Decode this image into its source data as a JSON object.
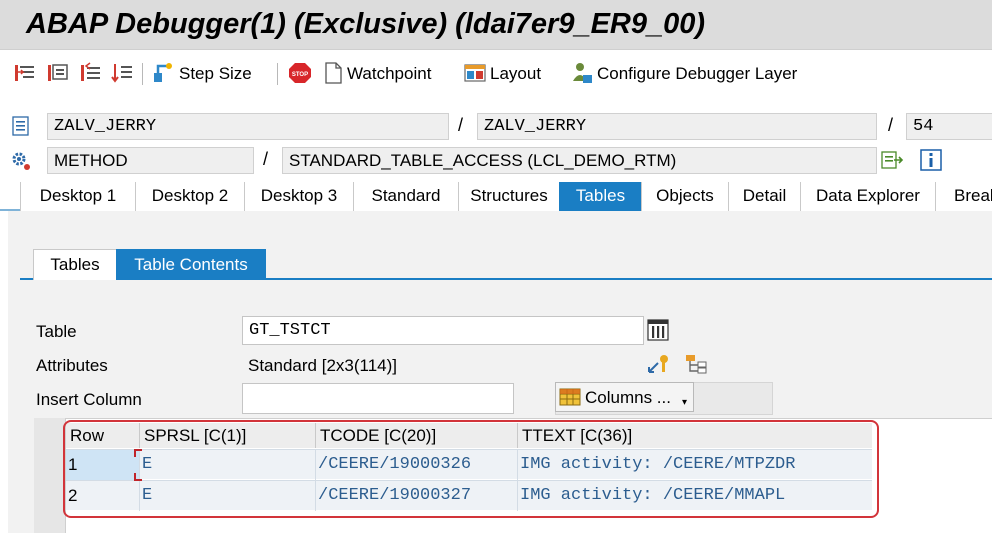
{
  "window": {
    "title": "ABAP Debugger(1)  (Exclusive) (ldai7er9_ER9_00)"
  },
  "toolbar": {
    "items": [
      {
        "label": "Step Size",
        "icon": "step-size-icon"
      },
      {
        "label": "Watchpoint",
        "icon": "watchpoint-icon"
      },
      {
        "label": "Layout",
        "icon": "layout-icon"
      },
      {
        "label": "Configure Debugger Layer",
        "icon": "configure-layer-icon"
      }
    ],
    "step_icons": [
      "single-step-icon",
      "execute-icon",
      "return-icon",
      "continue-icon"
    ]
  },
  "info": {
    "program": "ZALV_JERRY",
    "include": "ZALV_JERRY",
    "line": "54",
    "event_type": "METHOD",
    "event": "STANDARD_TABLE_ACCESS (LCL_DEMO_RTM)"
  },
  "main_tabs": [
    "Desktop 1",
    "Desktop 2",
    "Desktop 3",
    "Standard",
    "Structures",
    "Tables",
    "Objects",
    "Detail",
    "Data Explorer",
    "Break"
  ],
  "active_main_tab": "Tables",
  "sub_tabs": [
    "Tables",
    "Table Contents"
  ],
  "active_sub_tab": "Table Contents",
  "form": {
    "table_label": "Table",
    "table_value": "GT_TSTCT",
    "attributes_label": "Attributes",
    "attributes_value": "Standard [2x3(114)]",
    "insert_column_label": "Insert Column",
    "insert_column_value": "",
    "columns_button": "Columns ..."
  },
  "grid": {
    "headers": [
      "Row",
      "SPRSL [C(1)]",
      "TCODE [C(20)]",
      "TTEXT [C(36)]"
    ],
    "rows": [
      [
        "1",
        "E",
        "/CEERE/19000326",
        "IMG activity: /CEERE/MTPZDR"
      ],
      [
        "2",
        "E",
        "/CEERE/19000327",
        "IMG activity: /CEERE/MMAPL"
      ]
    ]
  },
  "colors": {
    "accent": "#1a7ec4",
    "highlight": "#d2343a",
    "cell_text": "#2c5d8f"
  }
}
